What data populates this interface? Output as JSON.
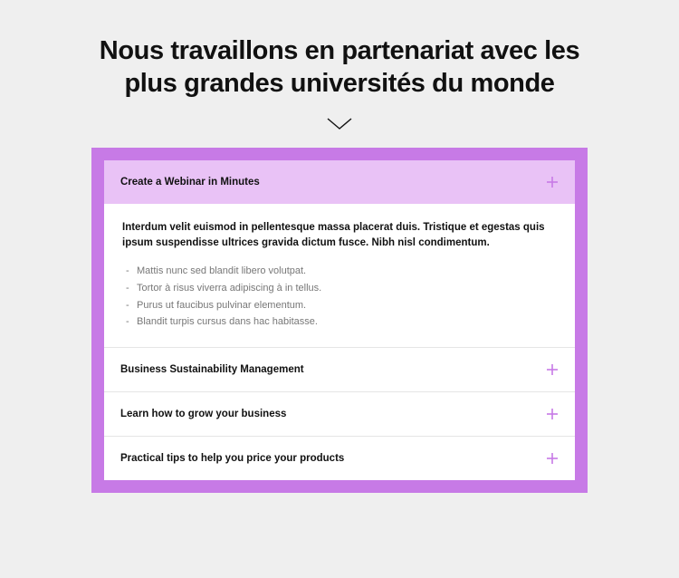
{
  "heading": "Nous travaillons en partenariat avec les plus grandes universités du monde",
  "accordion": [
    {
      "title": "Create a Webinar in Minutes",
      "expanded": true,
      "intro": "Interdum velit euismod in pellentesque massa placerat duis. Tristique et egestas quis ipsum suspendisse ultrices gravida dictum fusce. Nibh nisl condimentum.",
      "bullets": [
        "Mattis nunc sed blandit libero volutpat.",
        "Tortor à risus viverra adipiscing à in tellus.",
        "Purus ut faucibus pulvinar elementum.",
        "Blandit turpis cursus dans hac habitasse."
      ]
    },
    {
      "title": "Business Sustainability Management",
      "expanded": false
    },
    {
      "title": "Learn how to grow your business",
      "expanded": false
    },
    {
      "title": "Practical tips to help you price your products",
      "expanded": false
    }
  ]
}
